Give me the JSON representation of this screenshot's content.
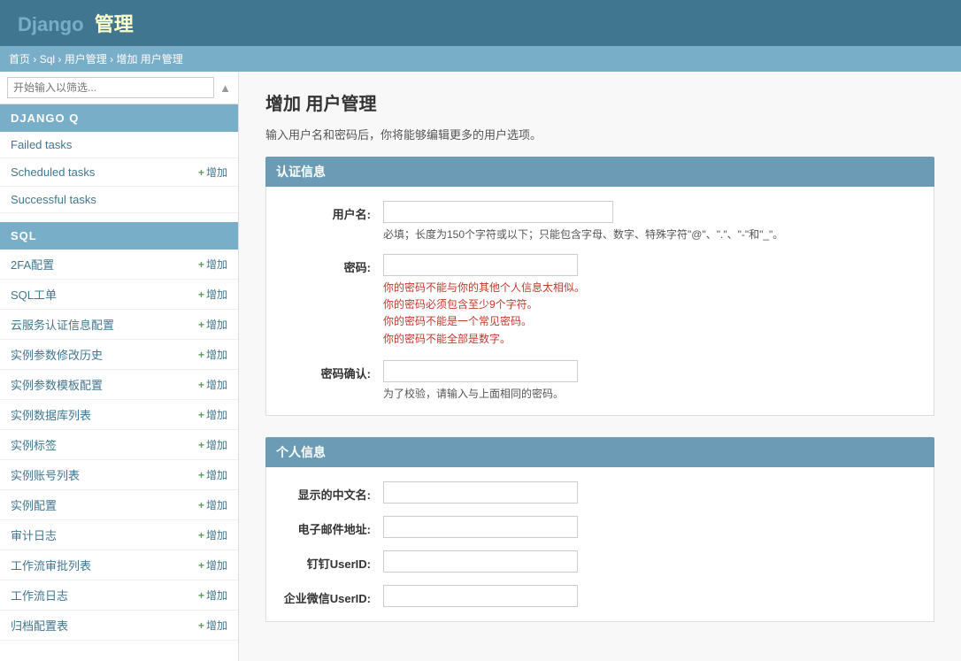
{
  "header": {
    "brand_prefix": "Django",
    "brand_suffix": "管理"
  },
  "breadcrumb": {
    "items": [
      "首页",
      "Sql",
      "用户管理",
      "增加 用户管理"
    ]
  },
  "sidebar": {
    "filter_placeholder": "开始输入以筛选...",
    "sections": [
      {
        "id": "django-q",
        "label": "DJANGO Q",
        "items": [
          {
            "label": "Failed tasks",
            "add": false
          },
          {
            "label": "Scheduled tasks",
            "add": true
          },
          {
            "label": "Successful tasks",
            "add": false
          }
        ]
      },
      {
        "id": "sql",
        "label": "SQL",
        "items": [
          {
            "label": "2FA配置",
            "add": true
          },
          {
            "label": "SQL工单",
            "add": true
          },
          {
            "label": "云服务认证信息配置",
            "add": true
          },
          {
            "label": "实例参数修改历史",
            "add": true
          },
          {
            "label": "实例参数模板配置",
            "add": true
          },
          {
            "label": "实例数据库列表",
            "add": true
          },
          {
            "label": "实例标签",
            "add": true
          },
          {
            "label": "实例账号列表",
            "add": true
          },
          {
            "label": "实例配置",
            "add": true
          },
          {
            "label": "审计日志",
            "add": true
          },
          {
            "label": "工作流审批列表",
            "add": true
          },
          {
            "label": "工作流日志",
            "add": true
          },
          {
            "label": "归档配置表",
            "add": true
          }
        ]
      }
    ],
    "add_label": "+ 增加",
    "add_plus": "+"
  },
  "main": {
    "title": "增加 用户管理",
    "intro": "输入用户名和密码后，你将能够编辑更多的用户选项。",
    "auth_section": {
      "header": "认证信息",
      "fields": [
        {
          "label": "用户名:",
          "type": "text",
          "name": "username",
          "value": "",
          "help": "必填；长度为150个字符或以下；只能包含字母、数字、特殊字符\"@\"、\".\"、\"-\"和\"_\"。"
        },
        {
          "label": "密码:",
          "type": "password",
          "name": "password1",
          "value": "",
          "hints": [
            "你的密码不能与你的其他个人信息太相似。",
            "你的密码必须包含至少9个字符。",
            "你的密码不能是一个常见密码。",
            "你的密码不能全部是数字。"
          ]
        },
        {
          "label": "密码确认:",
          "type": "password",
          "name": "password2",
          "value": "",
          "help": "为了校验，请输入与上面相同的密码。"
        }
      ]
    },
    "personal_section": {
      "header": "个人信息",
      "fields": [
        {
          "label": "显示的中文名:",
          "type": "text",
          "name": "display_name",
          "value": ""
        },
        {
          "label": "电子邮件地址:",
          "type": "email",
          "name": "email",
          "value": ""
        },
        {
          "label": "钉钉UserID:",
          "type": "text",
          "name": "dingtalk_id",
          "value": ""
        },
        {
          "label": "企业微信UserID:",
          "type": "text",
          "name": "wechat_id",
          "value": ""
        }
      ]
    }
  }
}
